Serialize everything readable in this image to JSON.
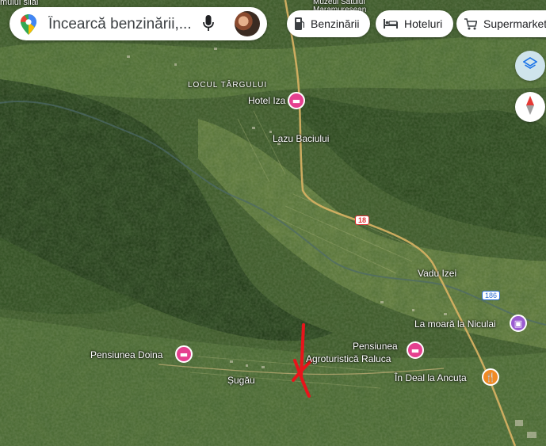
{
  "search": {
    "placeholder": "Încearcă benzinării,..."
  },
  "chips": [
    {
      "label": "Benzinării",
      "icon": "gas-station-icon"
    },
    {
      "label": "Hoteluri",
      "icon": "bed-icon"
    },
    {
      "label": "Supermarketu",
      "icon": "shopping-cart-icon"
    }
  ],
  "map": {
    "partial_labels": {
      "top_left": "mului silai",
      "top_center": "Muzeul Satului Maramureșean"
    },
    "places": [
      {
        "name": "LOCUL TÂRGULUI",
        "kind": "area"
      },
      {
        "name": "Hotel Iza",
        "kind": "hotel"
      },
      {
        "name": "Lazu Baciului",
        "kind": "locality"
      },
      {
        "name": "Vadu Izei",
        "kind": "locality"
      },
      {
        "name": "La moară la Niculai",
        "kind": "attraction"
      },
      {
        "name": "Pensiunea Doina",
        "kind": "hotel"
      },
      {
        "name": "Pensiunea",
        "kind": "hotel"
      },
      {
        "name": "Agroturistică Raluca",
        "kind": "hotel"
      },
      {
        "name": "Șugău",
        "kind": "locality"
      },
      {
        "name": "În Deal la Ancuța",
        "kind": "food"
      }
    ],
    "road_shields": [
      {
        "label": "18",
        "color": "#d33333"
      },
      {
        "label": "186",
        "color": "#2a6bd1"
      }
    ],
    "annotation": {
      "shape": "hand-drawn X with line",
      "color": "#e8141b"
    }
  },
  "controls": {
    "layers": "layers-icon",
    "compass": "compass-icon"
  },
  "colors": {
    "hotel_pin": "#e5408f",
    "food_pin": "#f08a24",
    "attraction_pin": "#9a5bd0",
    "road": "#c9a35a",
    "annotation": "#e8141b"
  }
}
